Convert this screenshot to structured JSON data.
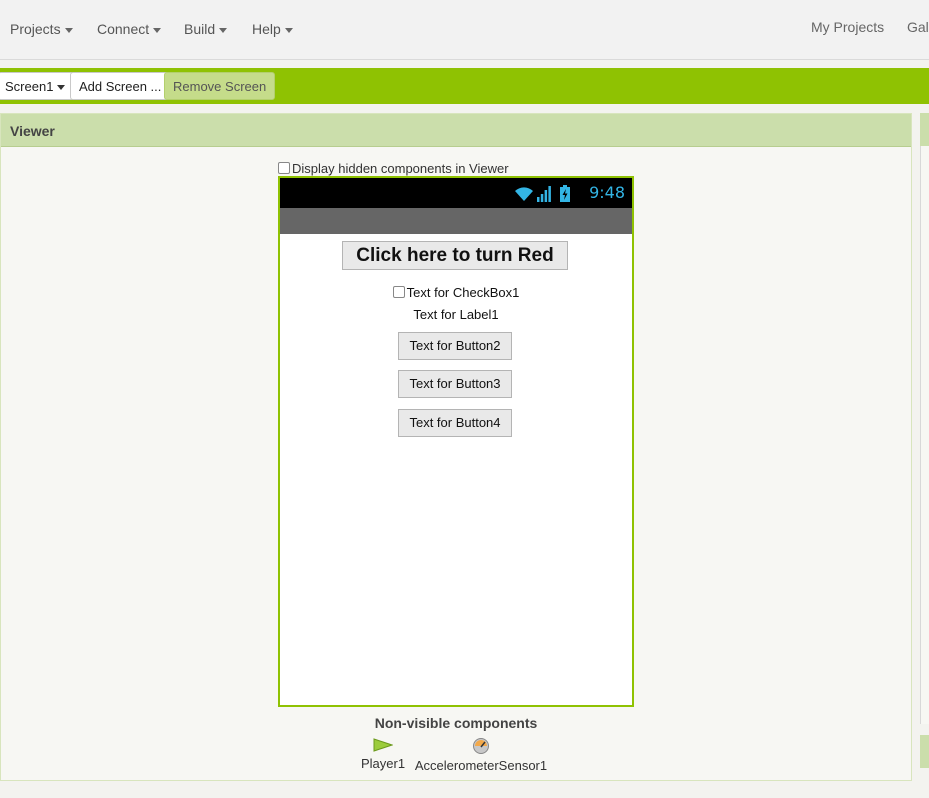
{
  "menu": {
    "items": [
      {
        "label": "Projects"
      },
      {
        "label": "Connect"
      },
      {
        "label": "Build"
      },
      {
        "label": "Help"
      }
    ],
    "right_links": [
      "My Projects",
      "Gall"
    ]
  },
  "toolbar": {
    "screen_select": "Screen1",
    "add_screen": "Add Screen ...",
    "remove_screen": "Remove Screen"
  },
  "viewer": {
    "title": "Viewer",
    "display_hidden_label": "Display hidden components in Viewer",
    "phone": {
      "clock": "9:48",
      "big_button": "Click here to turn Red",
      "checkbox_label": "Text for CheckBox1",
      "label": "Text for Label1",
      "buttons": [
        "Text for Button2",
        "Text for Button3",
        "Text for Button4"
      ]
    },
    "non_visible": {
      "title": "Non-visible components",
      "items": [
        {
          "label": "Player1",
          "icon": "player-icon"
        },
        {
          "label": "AccelerometerSensor1",
          "icon": "accelerometer-icon"
        }
      ]
    }
  },
  "colors": {
    "accent_green": "#8fc202",
    "header_green": "#cbdeab",
    "clock_blue": "#33b5e5"
  }
}
